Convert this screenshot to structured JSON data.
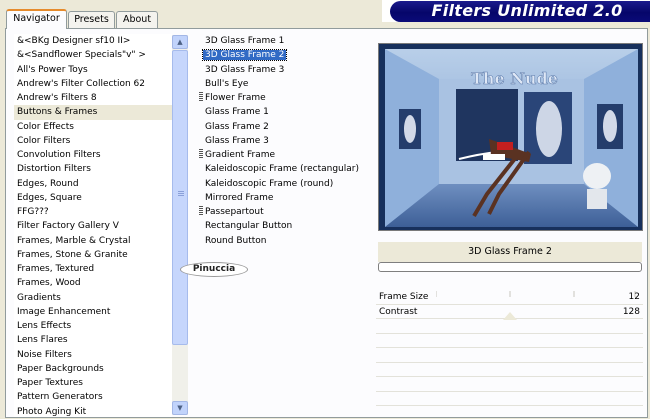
{
  "tabs": [
    {
      "label": "Navigator"
    },
    {
      "label": "Presets"
    },
    {
      "label": "About"
    }
  ],
  "banner": {
    "title": "Filters Unlimited 2.0"
  },
  "categories": [
    {
      "label": "&<BKg Designer sf10 II>"
    },
    {
      "label": "&<Sandflower Specials\"v\" >"
    },
    {
      "label": "All's Power Toys"
    },
    {
      "label": "Andrew's Filter Collection 62"
    },
    {
      "label": "Andrew's Filters 8"
    },
    {
      "label": "Buttons & Frames"
    },
    {
      "label": "Color Effects"
    },
    {
      "label": "Color Filters"
    },
    {
      "label": "Convolution Filters"
    },
    {
      "label": "Distortion Filters"
    },
    {
      "label": "Edges, Round"
    },
    {
      "label": "Edges, Square"
    },
    {
      "label": "FFG???"
    },
    {
      "label": "Filter Factory Gallery V"
    },
    {
      "label": "Frames, Marble & Crystal"
    },
    {
      "label": "Frames, Stone & Granite"
    },
    {
      "label": "Frames, Textured"
    },
    {
      "label": "Frames, Wood"
    },
    {
      "label": "Gradients"
    },
    {
      "label": "Image Enhancement"
    },
    {
      "label": "Lens Effects"
    },
    {
      "label": "Lens Flares"
    },
    {
      "label": "Noise Filters"
    },
    {
      "label": "Paper Backgrounds"
    },
    {
      "label": "Paper Textures"
    },
    {
      "label": "Pattern Generators"
    },
    {
      "label": "Photo Aging Kit"
    }
  ],
  "filters": [
    {
      "label": "3D Glass Frame 1",
      "marked": false
    },
    {
      "label": "3D Glass Frame 2",
      "marked": false
    },
    {
      "label": "3D Glass Frame 3",
      "marked": false
    },
    {
      "label": "Bull's Eye",
      "marked": false
    },
    {
      "label": "Flower Frame",
      "marked": true
    },
    {
      "label": "Glass Frame 1",
      "marked": false
    },
    {
      "label": "Glass Frame 2",
      "marked": false
    },
    {
      "label": "Glass Frame 3",
      "marked": false
    },
    {
      "label": "Gradient Frame",
      "marked": true
    },
    {
      "label": "Kaleidoscopic Frame (rectangular)",
      "marked": false
    },
    {
      "label": "Kaleidoscopic Frame (round)",
      "marked": false
    },
    {
      "label": "Mirrored Frame",
      "marked": false
    },
    {
      "label": "Passepartout",
      "marked": true
    },
    {
      "label": "Rectangular Button",
      "marked": false
    },
    {
      "label": "Round Button",
      "marked": false
    }
  ],
  "signature": {
    "text": "Pinuccia"
  },
  "preview": {
    "watermark": "The Nude"
  },
  "selected_filter": {
    "name": "3D Glass Frame 2",
    "progress": 0
  },
  "params": [
    {
      "label": "Frame Size",
      "value": "12"
    },
    {
      "label": "Contrast",
      "value": "128"
    }
  ],
  "scrollbar": {
    "up": "▲",
    "down": "▼"
  }
}
